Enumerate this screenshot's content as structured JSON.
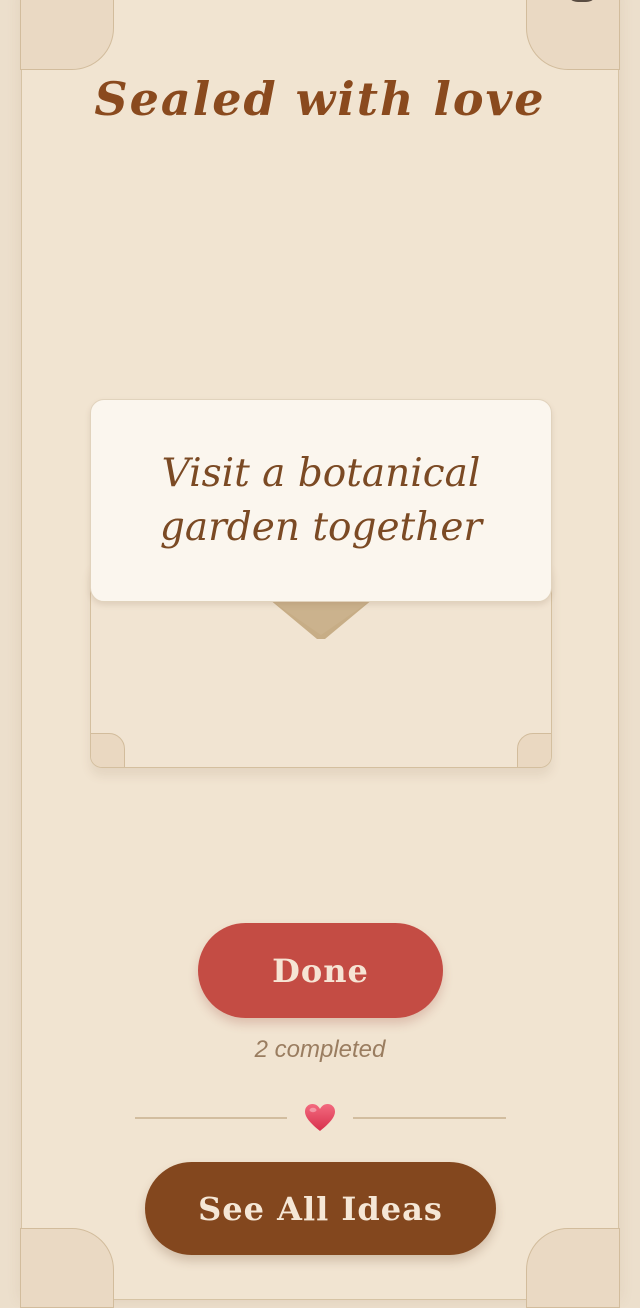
{
  "header": {
    "title": "Sealed with love"
  },
  "card": {
    "idea_text": "Visit a botanical garden together"
  },
  "actions": {
    "done_label": "Done",
    "completed_text": "2 completed",
    "see_all_label": "See All Ideas"
  },
  "icons": {
    "divider": "heart-icon",
    "flap": "envelope-flap-icon"
  },
  "colors": {
    "background": "#f1e4d1",
    "title": "#8a4a1e",
    "done_button": "#c44c44",
    "see_all_button": "#83471e",
    "heart": "#e8455f"
  }
}
